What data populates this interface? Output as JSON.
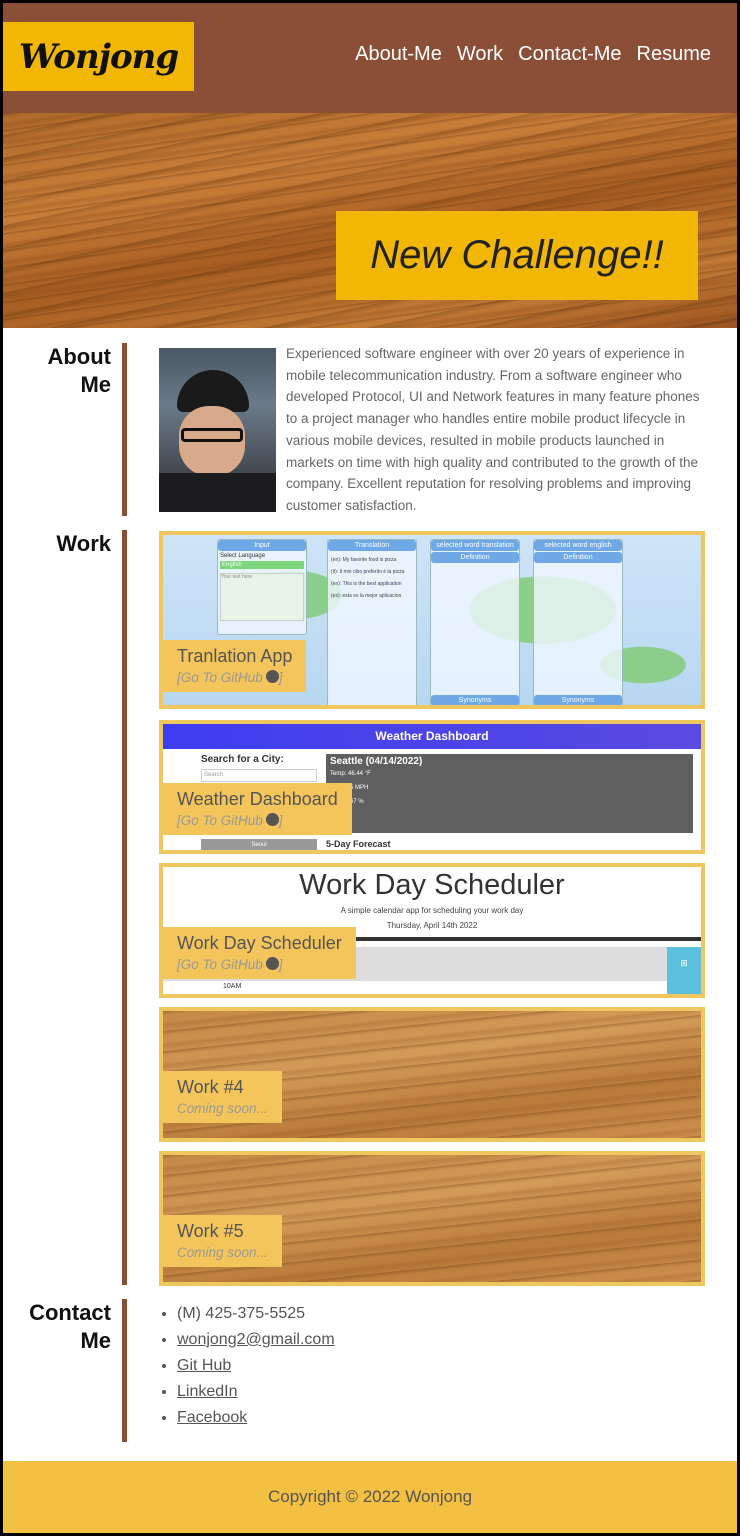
{
  "header": {
    "logo": "Wonjong",
    "nav": [
      "About-Me",
      "Work",
      "Contact-Me",
      "Resume"
    ]
  },
  "hero": {
    "banner": "New Challenge!!"
  },
  "about": {
    "title_line1": "About",
    "title_line2": "Me",
    "text": "Experienced software engineer with over 20 years of experience in mobile telecommunication industry. From a software engineer who developed Protocol, UI and Network features in many feature phones to a project manager who handles entire mobile product lifecycle in various mobile devices, resulted in mobile products launched in markets on time with high quality and contributed to the growth of the company. Excellent reputation for resolving problems and improving customer satisfaction."
  },
  "work": {
    "title": "Work",
    "cards": [
      {
        "title": "Tranlation App",
        "sub": "[Go To GitHub",
        "sub_end": "]"
      },
      {
        "title": "Weather Dashboard",
        "sub": "[Go To GitHub",
        "sub_end": "]"
      },
      {
        "title": "Work Day Scheduler",
        "sub": "[Go To GitHub",
        "sub_end": "]"
      },
      {
        "title": "Work #4",
        "sub": "Coming soon..."
      },
      {
        "title": "Work #5",
        "sub": "Coming soon..."
      }
    ],
    "translation_shot": {
      "headers": [
        "Input",
        "Translation",
        "selected word translation",
        "selected word english"
      ],
      "select_label": "Select Language",
      "select_value": "English",
      "input_placeholder": "Your text here",
      "lines": [
        "(en): My favorite food is pizza",
        "(it): Il mio cibo preferito è la pizza",
        "(en): This is the best application",
        "(es): esta es la mejor aplicacion"
      ],
      "sub_headers": [
        "Definition",
        "Definition"
      ],
      "footer_headers": [
        "Synonyms",
        "Synonyms"
      ]
    },
    "weather_shot": {
      "title": "Weather Dashboard",
      "search_label": "Search for a City:",
      "search_placeholder": "Search",
      "city": "Seattle (04/14/2022)",
      "temp": "Temp: 46.44 °F",
      "wind": "5 MPH",
      "humidity": "67 %",
      "history": "Seoul",
      "forecast": "5-Day Forecast"
    },
    "scheduler_shot": {
      "title": "Work Day Scheduler",
      "subtitle": "A simple calendar app for scheduling your work day",
      "date": "Thursday, April 14th 2022",
      "hour": "10AM"
    }
  },
  "contact": {
    "title_line1": "Contact",
    "title_line2": "Me",
    "phone": "(M) 425-375-5525",
    "links": [
      "wonjong2@gmail.com",
      "Git Hub",
      "LinkedIn",
      "Facebook"
    ]
  },
  "footer": {
    "text": "Copyright © 2022 Wonjong"
  },
  "colors": {
    "brown": "#8b4f38",
    "yellow": "#f2b705",
    "card_border": "#f0c75e",
    "footer": "#f3c041"
  }
}
